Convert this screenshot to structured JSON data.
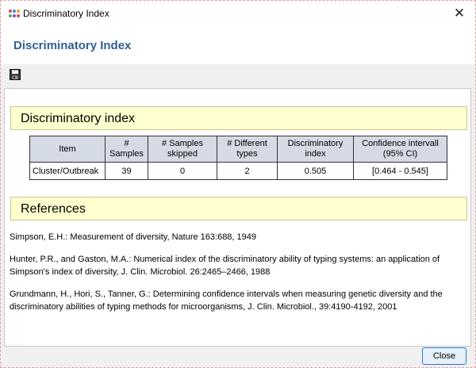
{
  "window": {
    "title": "Discriminatory Index",
    "close_glyph": "✕"
  },
  "header": {
    "title": "Discriminatory Index"
  },
  "toolbar": {
    "icons": [
      "save-icon"
    ]
  },
  "sections": {
    "index_title": "Discriminatory index",
    "references_title": "References"
  },
  "table": {
    "headers": [
      "Item",
      "#\nSamples",
      "# Samples\nskipped",
      "# Different\ntypes",
      "Discriminatory\nindex",
      "Confidence intervall\n(95% CI)"
    ],
    "rows": [
      [
        "Cluster/Outbreak",
        "39",
        "0",
        "2",
        "0.505",
        "[0.464 - 0.545]"
      ]
    ]
  },
  "references": [
    "Simpson, E.H.: Measurement of diversity, Nature 163:688, 1949",
    "Hunter, P.R., and Gaston, M.A.: Numerical index of the discriminatory ability of typing systems: an application of Simpson's index of diversity, J. Clin. Microbiol. 26:2465–2466, 1988",
    "Grundmann, H., Hori, S., Tanner, G.: Determining confidence intervals when measuring genetic diversity and the discriminatory abilities of typing methods for microorganisms, J. Clin. Microbiol., 39:4190-4192, 2001"
  ],
  "buttons": {
    "close_label": "Close"
  },
  "colors": {
    "header_title": "#2f5f93",
    "section_background": "#ffffcf",
    "table_header_background": "#d4dbe4",
    "button_border": "#3078d0"
  }
}
